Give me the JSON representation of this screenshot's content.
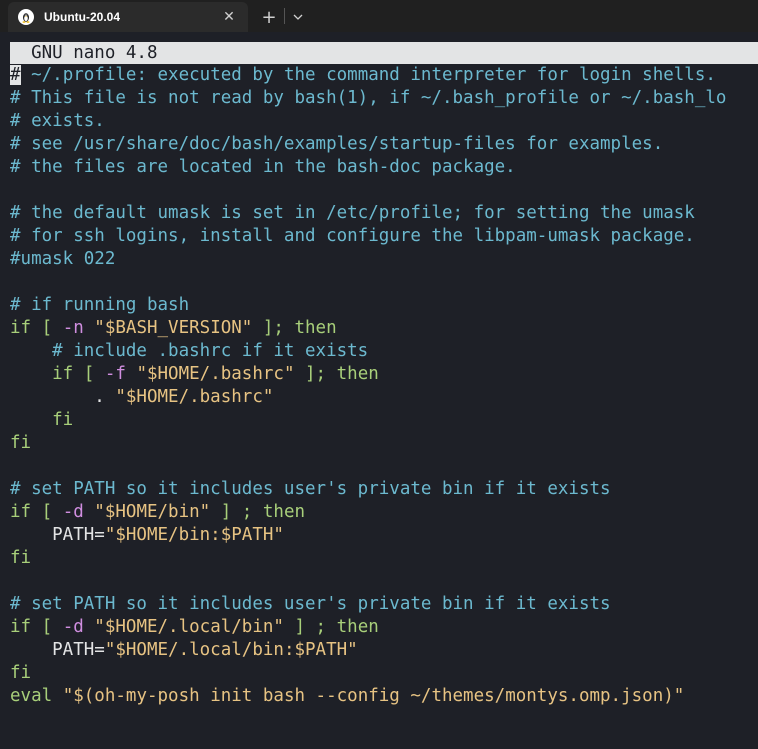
{
  "window": {
    "tab_title": "Ubuntu-20.04",
    "tab_icon": "linux-tux-icon",
    "close_glyph": "✕",
    "new_tab_glyph": "+",
    "dropdown_glyph": "⌄"
  },
  "nano": {
    "header": "  GNU nano 4.8"
  },
  "colors": {
    "background": "#1e2027",
    "comment": "#6cb9cf",
    "keyword": "#a8cf7a",
    "flag": "#d08ee0",
    "string": "#e7c383",
    "text": "#e3e4e5"
  },
  "lines": [
    [
      {
        "t": "#",
        "c": "cursor"
      },
      {
        "t": " ~/.profile: executed by the command interpreter for login shells.",
        "c": "comment"
      }
    ],
    [
      {
        "t": "# This file is not read by bash(1), if ~/.bash_profile or ~/.bash_lo",
        "c": "comment"
      }
    ],
    [
      {
        "t": "# exists.",
        "c": "comment"
      }
    ],
    [
      {
        "t": "# see /usr/share/doc/bash/examples/startup-files for examples.",
        "c": "comment"
      }
    ],
    [
      {
        "t": "# the files are located in the bash-doc package.",
        "c": "comment"
      }
    ],
    [],
    [
      {
        "t": "# the default umask is set in /etc/profile; for setting the umask",
        "c": "comment"
      }
    ],
    [
      {
        "t": "# for ssh logins, install and configure the libpam-umask package.",
        "c": "comment"
      }
    ],
    [
      {
        "t": "#umask 022",
        "c": "comment"
      }
    ],
    [],
    [
      {
        "t": "# if running bash",
        "c": "comment"
      }
    ],
    [
      {
        "t": "if [ ",
        "c": "kw"
      },
      {
        "t": "-n",
        "c": "flag"
      },
      {
        "t": " \"$BASH_VERSION\"",
        "c": "str"
      },
      {
        "t": " ]; then",
        "c": "kw"
      }
    ],
    [
      {
        "t": "    # include .bashrc if it exists",
        "c": "comment"
      }
    ],
    [
      {
        "t": "    if [ ",
        "c": "kw"
      },
      {
        "t": "-f",
        "c": "flag"
      },
      {
        "t": " \"$HOME/.bashrc\"",
        "c": "str"
      },
      {
        "t": " ]; then",
        "c": "kw"
      }
    ],
    [
      {
        "t": "        . ",
        "c": "plain"
      },
      {
        "t": "\"$HOME/.bashrc\"",
        "c": "str"
      }
    ],
    [
      {
        "t": "    fi",
        "c": "kw"
      }
    ],
    [
      {
        "t": "fi",
        "c": "kw"
      }
    ],
    [],
    [
      {
        "t": "# set PATH so it includes user's private bin if it exists",
        "c": "comment"
      }
    ],
    [
      {
        "t": "if [ ",
        "c": "kw"
      },
      {
        "t": "-d",
        "c": "flag"
      },
      {
        "t": " \"$HOME/bin\"",
        "c": "str"
      },
      {
        "t": " ] ; then",
        "c": "kw"
      }
    ],
    [
      {
        "t": "    PATH=",
        "c": "plain"
      },
      {
        "t": "\"$HOME/bin:$PATH\"",
        "c": "str"
      }
    ],
    [
      {
        "t": "fi",
        "c": "kw"
      }
    ],
    [],
    [
      {
        "t": "# set PATH so it includes user's private bin if it exists",
        "c": "comment"
      }
    ],
    [
      {
        "t": "if [ ",
        "c": "kw"
      },
      {
        "t": "-d",
        "c": "flag"
      },
      {
        "t": " \"$HOME/.local/bin\"",
        "c": "str"
      },
      {
        "t": " ] ; then",
        "c": "kw"
      }
    ],
    [
      {
        "t": "    PATH=",
        "c": "plain"
      },
      {
        "t": "\"$HOME/.local/bin:$PATH\"",
        "c": "str"
      }
    ],
    [
      {
        "t": "fi",
        "c": "kw"
      }
    ],
    [
      {
        "t": "eval ",
        "c": "kw"
      },
      {
        "t": "\"$(oh-my-posh init bash --config ~/themes/montys.omp.json)\"",
        "c": "str"
      }
    ]
  ]
}
